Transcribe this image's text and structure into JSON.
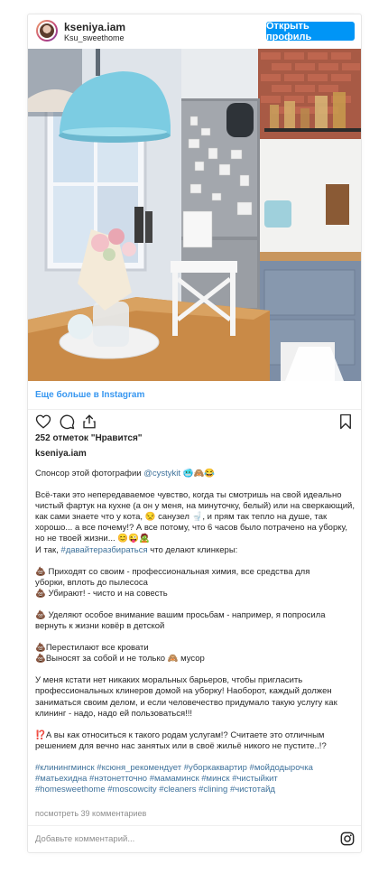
{
  "header": {
    "username": "kseniya.iam",
    "subtitle": "Ksu_sweethome",
    "open_profile": "Открыть профиль"
  },
  "more_link": "Еще больше в Instagram",
  "likes": "252 отметок \"Нравится\"",
  "author": "kseniya.iam",
  "caption": {
    "p1_text": "Спонсор этой фотографии ",
    "p1_tag": "@cystykit",
    "p2_l1": "Всё-таки это непередаваемое чувство, когда ты смотришь на свой идеально",
    "p2_l2": "чистый фартук на кухне (а он у меня, на минуточку, белый) или на сверкающий,",
    "p2_l3a": "как сами знаете что у кота,",
    "p2_l3b": "санузел",
    "p2_l3c": ", и прям так тепло на душе, так",
    "p2_l4": "хорошо... а все почему!? А все потому, что 6 часов было потрачено на уборку,",
    "p2_l5": "но не твоей жизни...",
    "p2_l6a": "И так, ",
    "p2_l6tag": "#давайтеразбираться",
    "p2_l6b": " что делают клинкеры:",
    "p3_l1": "Приходят со своим - профессиональная химия, все средства для",
    "p3_l2": "уборки, вплоть до пылесоса",
    "p3_l3": "Убирают! - чисто и на совесть",
    "p4_l1": "Уделяют особое внимание вашим просьбам - например, я попросила",
    "p4_l2": "вернуть к жизни ковёр в детской",
    "p5_l1": "Перестилают все кровати",
    "p5_l2a": "Выносят за собой и не только",
    "p5_l2b": "мусор",
    "p6_l1": "У меня кстати нет никаких моральных барьеров, чтобы пригласить",
    "p6_l2": "профессиональных клинеров домой на уборку! Наоборот, каждый должен",
    "p6_l3": "заниматься своим делом, и если человечество придумало такую услугу как",
    "p6_l4": "клининг - надо, надо ей пользоваться!!!",
    "p7_l1": "⁉️А вы как относиться к такого родам услугам!? Считаете это отличным",
    "p7_l2": "решением для вечно нас занятых или в своё жильё никого не пустите..!?",
    "tags_l1": "#клинингминск #ксюня_рекомендует #уборкаквартир #мойдодырочка",
    "tags_l2": "#матьехидна #нэтонетточно #мамаминск #минск #чистыйкит",
    "tags_l3": "#homesweethome #moscowcity #cleaners #clining #чистотайд"
  },
  "comments_count": "посмотреть 39 комментариев",
  "add_comment_placeholder": "Добавьте комментарий...",
  "icons": [
    "heart-icon",
    "comment-icon",
    "share-icon",
    "bookmark-icon",
    "instagram-icon"
  ],
  "colors": {
    "accent": "#0095f6",
    "link": "#3897f0",
    "hashtag": "#3f729b",
    "muted": "#8e8e8e"
  }
}
